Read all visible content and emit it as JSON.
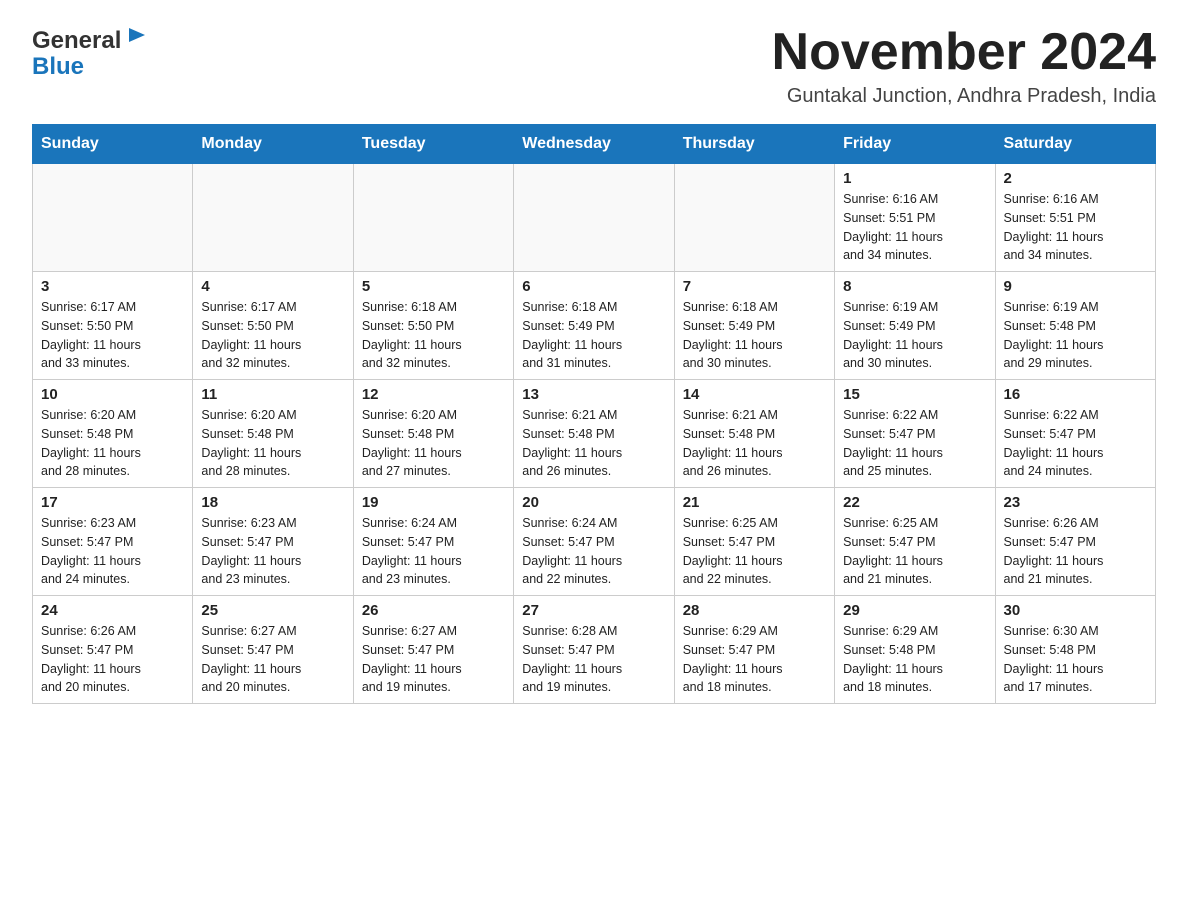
{
  "logo": {
    "line1": "General",
    "line2": "Blue"
  },
  "header": {
    "title": "November 2024",
    "subtitle": "Guntakal Junction, Andhra Pradesh, India"
  },
  "calendar": {
    "days_of_week": [
      "Sunday",
      "Monday",
      "Tuesday",
      "Wednesday",
      "Thursday",
      "Friday",
      "Saturday"
    ],
    "weeks": [
      [
        {
          "num": "",
          "info": ""
        },
        {
          "num": "",
          "info": ""
        },
        {
          "num": "",
          "info": ""
        },
        {
          "num": "",
          "info": ""
        },
        {
          "num": "",
          "info": ""
        },
        {
          "num": "1",
          "info": "Sunrise: 6:16 AM\nSunset: 5:51 PM\nDaylight: 11 hours\nand 34 minutes."
        },
        {
          "num": "2",
          "info": "Sunrise: 6:16 AM\nSunset: 5:51 PM\nDaylight: 11 hours\nand 34 minutes."
        }
      ],
      [
        {
          "num": "3",
          "info": "Sunrise: 6:17 AM\nSunset: 5:50 PM\nDaylight: 11 hours\nand 33 minutes."
        },
        {
          "num": "4",
          "info": "Sunrise: 6:17 AM\nSunset: 5:50 PM\nDaylight: 11 hours\nand 32 minutes."
        },
        {
          "num": "5",
          "info": "Sunrise: 6:18 AM\nSunset: 5:50 PM\nDaylight: 11 hours\nand 32 minutes."
        },
        {
          "num": "6",
          "info": "Sunrise: 6:18 AM\nSunset: 5:49 PM\nDaylight: 11 hours\nand 31 minutes."
        },
        {
          "num": "7",
          "info": "Sunrise: 6:18 AM\nSunset: 5:49 PM\nDaylight: 11 hours\nand 30 minutes."
        },
        {
          "num": "8",
          "info": "Sunrise: 6:19 AM\nSunset: 5:49 PM\nDaylight: 11 hours\nand 30 minutes."
        },
        {
          "num": "9",
          "info": "Sunrise: 6:19 AM\nSunset: 5:48 PM\nDaylight: 11 hours\nand 29 minutes."
        }
      ],
      [
        {
          "num": "10",
          "info": "Sunrise: 6:20 AM\nSunset: 5:48 PM\nDaylight: 11 hours\nand 28 minutes."
        },
        {
          "num": "11",
          "info": "Sunrise: 6:20 AM\nSunset: 5:48 PM\nDaylight: 11 hours\nand 28 minutes."
        },
        {
          "num": "12",
          "info": "Sunrise: 6:20 AM\nSunset: 5:48 PM\nDaylight: 11 hours\nand 27 minutes."
        },
        {
          "num": "13",
          "info": "Sunrise: 6:21 AM\nSunset: 5:48 PM\nDaylight: 11 hours\nand 26 minutes."
        },
        {
          "num": "14",
          "info": "Sunrise: 6:21 AM\nSunset: 5:48 PM\nDaylight: 11 hours\nand 26 minutes."
        },
        {
          "num": "15",
          "info": "Sunrise: 6:22 AM\nSunset: 5:47 PM\nDaylight: 11 hours\nand 25 minutes."
        },
        {
          "num": "16",
          "info": "Sunrise: 6:22 AM\nSunset: 5:47 PM\nDaylight: 11 hours\nand 24 minutes."
        }
      ],
      [
        {
          "num": "17",
          "info": "Sunrise: 6:23 AM\nSunset: 5:47 PM\nDaylight: 11 hours\nand 24 minutes."
        },
        {
          "num": "18",
          "info": "Sunrise: 6:23 AM\nSunset: 5:47 PM\nDaylight: 11 hours\nand 23 minutes."
        },
        {
          "num": "19",
          "info": "Sunrise: 6:24 AM\nSunset: 5:47 PM\nDaylight: 11 hours\nand 23 minutes."
        },
        {
          "num": "20",
          "info": "Sunrise: 6:24 AM\nSunset: 5:47 PM\nDaylight: 11 hours\nand 22 minutes."
        },
        {
          "num": "21",
          "info": "Sunrise: 6:25 AM\nSunset: 5:47 PM\nDaylight: 11 hours\nand 22 minutes."
        },
        {
          "num": "22",
          "info": "Sunrise: 6:25 AM\nSunset: 5:47 PM\nDaylight: 11 hours\nand 21 minutes."
        },
        {
          "num": "23",
          "info": "Sunrise: 6:26 AM\nSunset: 5:47 PM\nDaylight: 11 hours\nand 21 minutes."
        }
      ],
      [
        {
          "num": "24",
          "info": "Sunrise: 6:26 AM\nSunset: 5:47 PM\nDaylight: 11 hours\nand 20 minutes."
        },
        {
          "num": "25",
          "info": "Sunrise: 6:27 AM\nSunset: 5:47 PM\nDaylight: 11 hours\nand 20 minutes."
        },
        {
          "num": "26",
          "info": "Sunrise: 6:27 AM\nSunset: 5:47 PM\nDaylight: 11 hours\nand 19 minutes."
        },
        {
          "num": "27",
          "info": "Sunrise: 6:28 AM\nSunset: 5:47 PM\nDaylight: 11 hours\nand 19 minutes."
        },
        {
          "num": "28",
          "info": "Sunrise: 6:29 AM\nSunset: 5:47 PM\nDaylight: 11 hours\nand 18 minutes."
        },
        {
          "num": "29",
          "info": "Sunrise: 6:29 AM\nSunset: 5:48 PM\nDaylight: 11 hours\nand 18 minutes."
        },
        {
          "num": "30",
          "info": "Sunrise: 6:30 AM\nSunset: 5:48 PM\nDaylight: 11 hours\nand 17 minutes."
        }
      ]
    ]
  }
}
